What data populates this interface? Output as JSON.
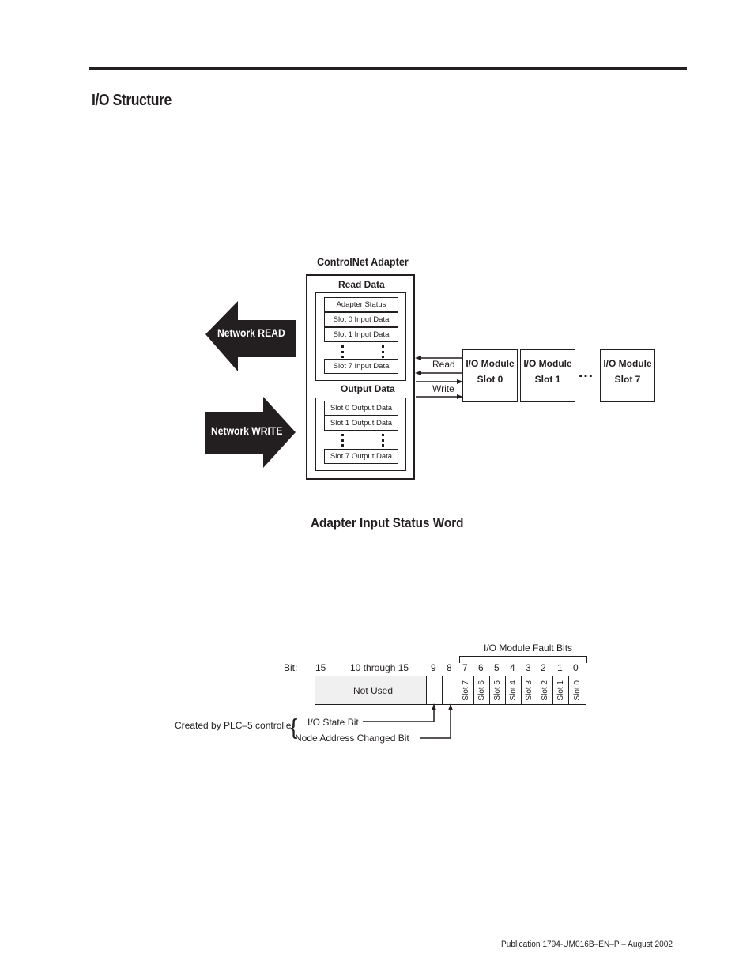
{
  "page": {
    "section_title": "I/O Structure",
    "footer": "Publication 1794-UM016B–EN–P – August 2002"
  },
  "io_diagram": {
    "adapter_title": "ControlNet Adapter",
    "read_data": {
      "title": "Read Data",
      "rows": [
        "Adapter Status",
        "Slot 0 Input Data",
        "Slot 1 Input Data",
        "Slot 7 Input Data"
      ]
    },
    "output_data": {
      "title": "Output Data",
      "rows": [
        "Slot 0 Output Data",
        "Slot 1 Output Data",
        "Slot 7 Output Data"
      ]
    },
    "network_read": "Network READ",
    "network_write": "Network WRITE",
    "read_label": "Read",
    "write_label": "Write",
    "ellipsis": "…",
    "modules": [
      {
        "line1": "I/O Module",
        "line2": "Slot 0"
      },
      {
        "line1": "I/O Module",
        "line2": "Slot 1"
      },
      {
        "line1": "I/O Module",
        "line2": "Slot 7"
      }
    ]
  },
  "status_word": {
    "title": "Adapter Input Status Word",
    "fault_bits_label": "I/O Module Fault Bits",
    "bit_label": "Bit:",
    "bit_15": "15",
    "bit_range": "10 through 15",
    "bit_numbers": [
      "9",
      "8",
      "7",
      "6",
      "5",
      "4",
      "3",
      "2",
      "1",
      "0"
    ],
    "not_used": "Not Used",
    "slots": [
      "Slot 7",
      "Slot 6",
      "Slot 5",
      "Slot 4",
      "Slot 3",
      "Slot 2",
      "Slot 1",
      "Slot 0"
    ],
    "created_by": "Created by PLC–5 controller",
    "io_state_bit": "I/O State Bit",
    "node_address_changed_bit": "Node Address Changed Bit"
  },
  "colors": {
    "ink": "#231f20",
    "not_used_fill": "#f0f0f0"
  }
}
